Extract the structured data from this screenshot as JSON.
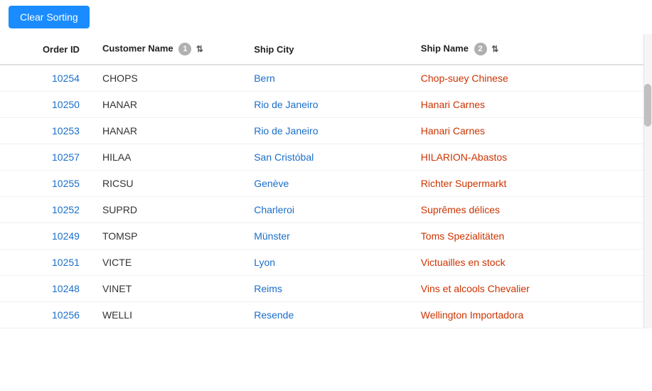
{
  "toolbar": {
    "clear_sorting_label": "Clear Sorting"
  },
  "table": {
    "columns": [
      {
        "key": "order_id",
        "label": "Order ID",
        "sort_badge": null,
        "sort_icon": null
      },
      {
        "key": "customer_name",
        "label": "Customer Name",
        "sort_badge": "1",
        "sort_icon": "↑="
      },
      {
        "key": "ship_city",
        "label": "Ship City",
        "sort_badge": null,
        "sort_icon": null
      },
      {
        "key": "ship_name",
        "label": "Ship Name",
        "sort_badge": "2",
        "sort_icon": "↑="
      }
    ],
    "rows": [
      {
        "order_id": "10254",
        "customer_name": "CHOPS",
        "ship_city": "Bern",
        "ship_name": "Chop-suey Chinese"
      },
      {
        "order_id": "10250",
        "customer_name": "HANAR",
        "ship_city": "Rio de Janeiro",
        "ship_name": "Hanari Carnes"
      },
      {
        "order_id": "10253",
        "customer_name": "HANAR",
        "ship_city": "Rio de Janeiro",
        "ship_name": "Hanari Carnes"
      },
      {
        "order_id": "10257",
        "customer_name": "HILAA",
        "ship_city": "San Cristóbal",
        "ship_name": "HILARION-Abastos"
      },
      {
        "order_id": "10255",
        "customer_name": "RICSU",
        "ship_city": "Genève",
        "ship_name": "Richter Supermarkt"
      },
      {
        "order_id": "10252",
        "customer_name": "SUPRD",
        "ship_city": "Charleroi",
        "ship_name": "Suprêmes délices"
      },
      {
        "order_id": "10249",
        "customer_name": "TOMSP",
        "ship_city": "Münster",
        "ship_name": "Toms Spezialitäten"
      },
      {
        "order_id": "10251",
        "customer_name": "VICTE",
        "ship_city": "Lyon",
        "ship_name": "Victuailles en stock"
      },
      {
        "order_id": "10248",
        "customer_name": "VINET",
        "ship_city": "Reims",
        "ship_name": "Vins et alcools Chevalier"
      },
      {
        "order_id": "10256",
        "customer_name": "WELLI",
        "ship_city": "Resende",
        "ship_name": "Wellington Importadora"
      }
    ]
  }
}
